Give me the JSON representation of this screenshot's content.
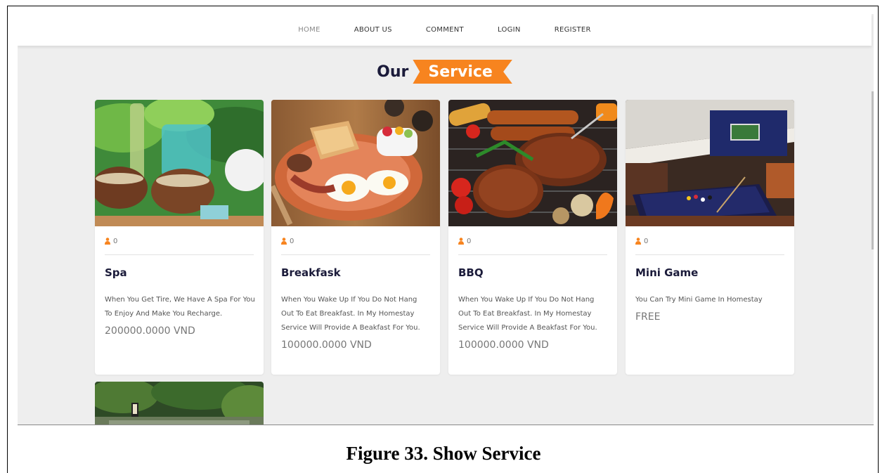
{
  "nav": {
    "items": [
      {
        "label": "HOME",
        "active": true
      },
      {
        "label": "ABOUT US",
        "active": false
      },
      {
        "label": "COMMENT",
        "active": false
      },
      {
        "label": "LOGIN",
        "active": false
      },
      {
        "label": "REGISTER",
        "active": false
      }
    ]
  },
  "section": {
    "title_part1": "Our",
    "title_part2": "Service"
  },
  "colors": {
    "accent": "#f7841f",
    "title_dark": "#1b1b3a"
  },
  "icons": {
    "meta": "person-icon"
  },
  "cards": [
    {
      "count": "0",
      "title": "Spa",
      "description": "When You Get Tire, We Have A Spa For You To Enjoy And Make You Recharge.",
      "price": "200000.0000 VND"
    },
    {
      "count": "0",
      "title": "Breakfask",
      "description": "When You Wake Up If You Do Not Hang Out To Eat Breakfast. In My Homestay Service Will Provide A Beakfast For You.",
      "price": "100000.0000 VND"
    },
    {
      "count": "0",
      "title": "BBQ",
      "description": "When You Wake Up If You Do Not Hang Out To Eat Breakfast. In My Homestay Service Will Provide A Beakfast For You.",
      "price": "100000.0000 VND"
    },
    {
      "count": "0",
      "title": "Mini Game",
      "description": "You Can Try Mini Game In Homestay",
      "price": "FREE"
    }
  ],
  "caption": "Figure 33. Show Service"
}
